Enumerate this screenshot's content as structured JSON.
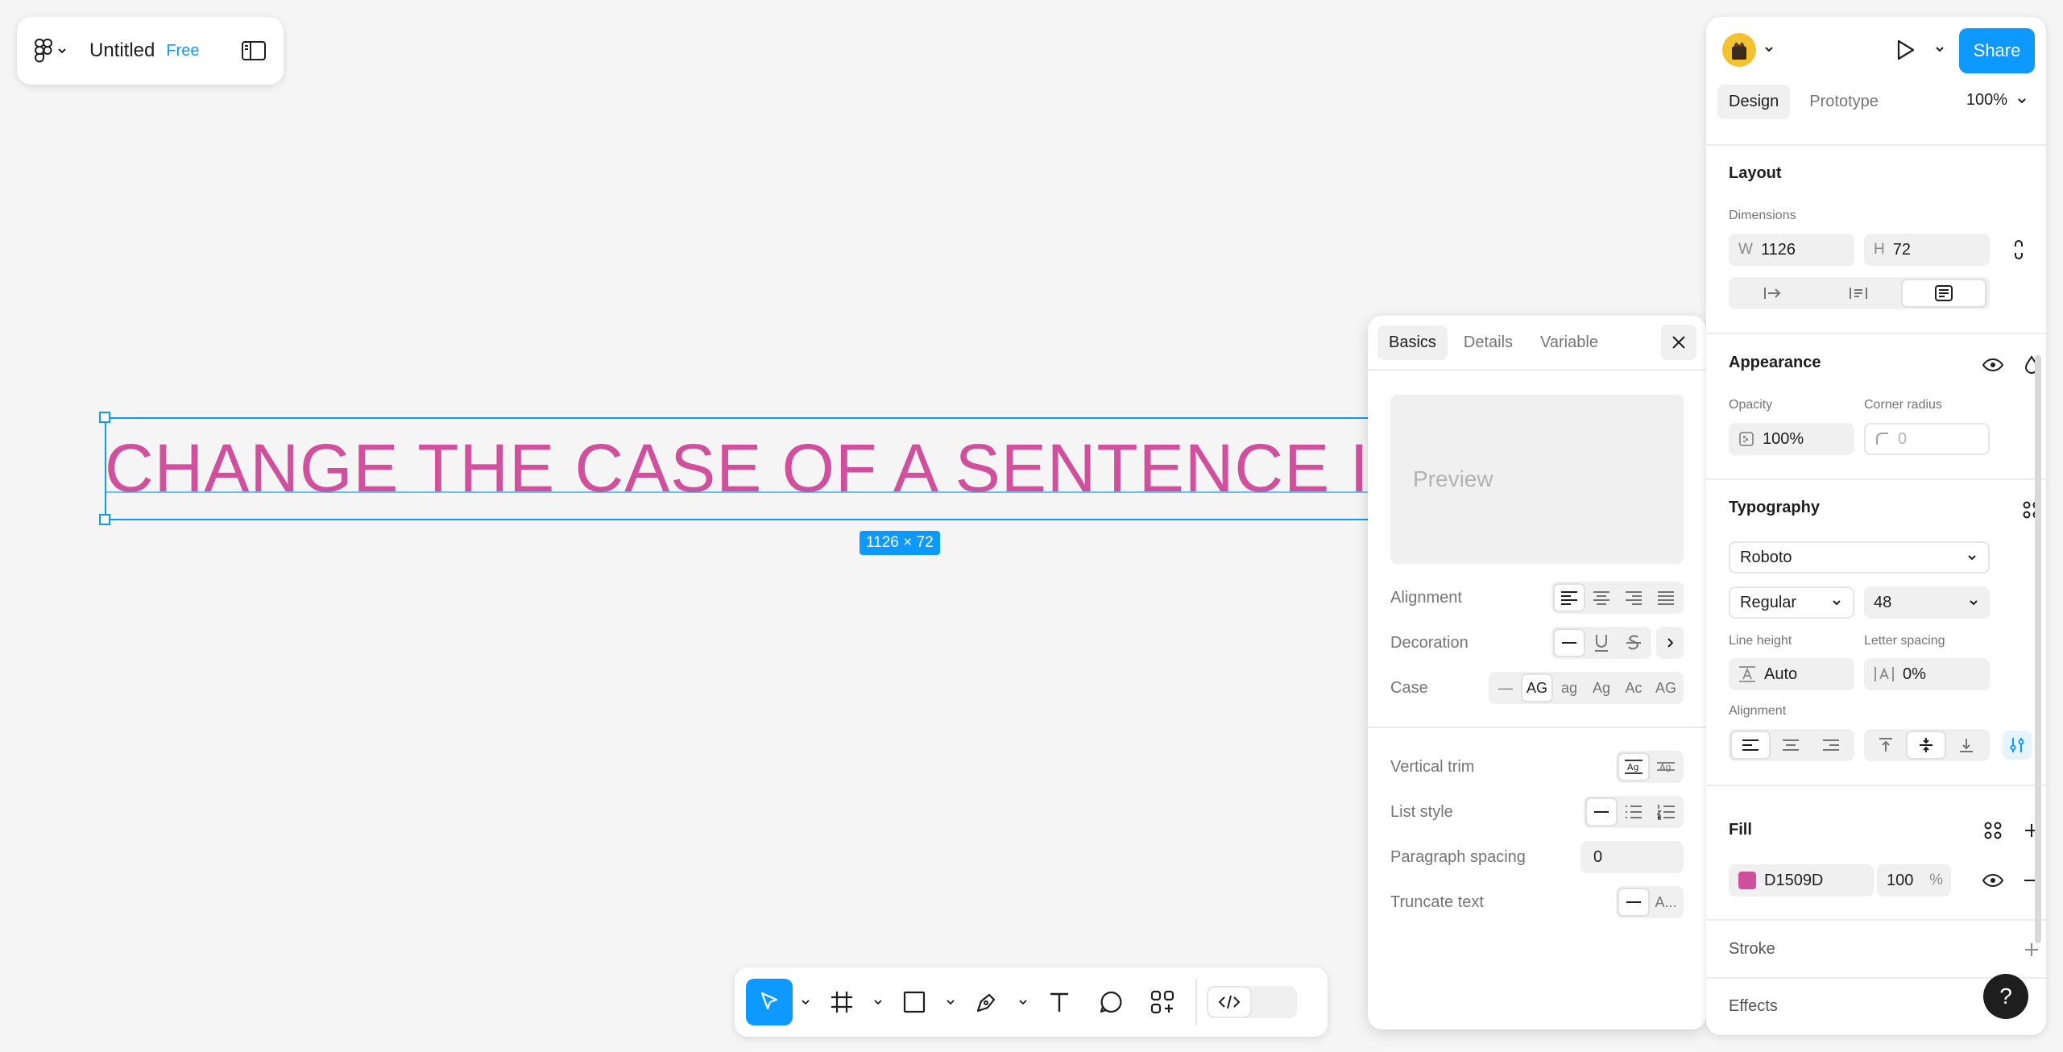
{
  "file": {
    "title": "Untitled",
    "plan_badge": "Free"
  },
  "canvas": {
    "text_content": "CHANGE THE CASE OF A SENTENCE IN FI",
    "dimension_label": "1126 × 72",
    "text_color": "#d1509d",
    "selection_color": "#0d99ff"
  },
  "toolbar": {
    "tools": [
      "move-tool",
      "frame-tool",
      "shape-tool",
      "pen-tool",
      "text-tool",
      "comment-tool",
      "actions-tool"
    ]
  },
  "popover": {
    "tabs": [
      "Basics",
      "Details",
      "Variable"
    ],
    "active_tab": "Basics",
    "preview_placeholder": "Preview",
    "alignment_label": "Alignment",
    "decoration_label": "Decoration",
    "case_label": "Case",
    "case_options": [
      "—",
      "AG",
      "ag",
      "Ag",
      "Ac",
      "AG"
    ],
    "vertical_trim_label": "Vertical trim",
    "list_style_label": "List style",
    "paragraph_spacing_label": "Paragraph spacing",
    "paragraph_spacing_value": "0",
    "truncate_label": "Truncate text",
    "truncate_option": "A..."
  },
  "panel": {
    "share_label": "Share",
    "tabs": [
      "Design",
      "Prototype"
    ],
    "zoom": "100%",
    "layout": {
      "title": "Layout",
      "dimensions_label": "Dimensions",
      "w_prefix": "W",
      "w_value": "1126",
      "h_prefix": "H",
      "h_value": "72"
    },
    "appearance": {
      "title": "Appearance",
      "opacity_label": "Opacity",
      "opacity_value": "100%",
      "radius_label": "Corner radius",
      "radius_value": "0"
    },
    "typography": {
      "title": "Typography",
      "font": "Roboto",
      "weight": "Regular",
      "size": "48",
      "line_height_label": "Line height",
      "line_height_value": "Auto",
      "letter_spacing_label": "Letter spacing",
      "letter_spacing_value": "0%",
      "alignment_label": "Alignment"
    },
    "fill": {
      "title": "Fill",
      "hex": "D1509D",
      "opacity": "100",
      "unit": "%",
      "swatch_color": "#d1509d"
    },
    "stroke": {
      "title": "Stroke"
    },
    "effects": {
      "title": "Effects"
    }
  },
  "help_label": "?"
}
